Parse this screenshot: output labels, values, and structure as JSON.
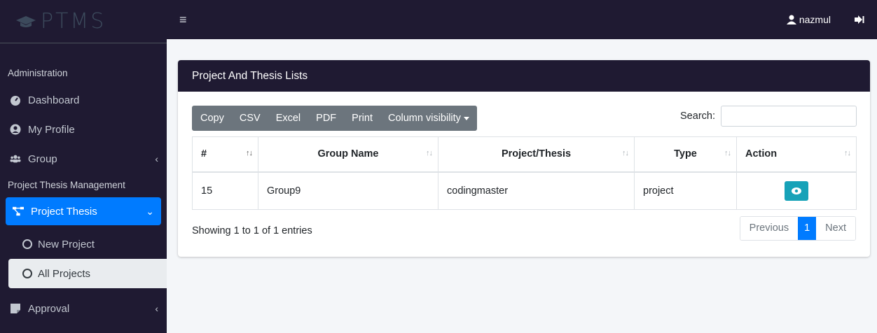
{
  "brand": {
    "text": "PTMS"
  },
  "sidebar": {
    "header_admin": "Administration",
    "dashboard": "Dashboard",
    "profile": "My Profile",
    "group": "Group",
    "header_pt": "Project Thesis Management",
    "project_thesis": "Project Thesis",
    "new_project": "New Project",
    "all_projects": "All Projects",
    "approval": "Approval"
  },
  "topbar": {
    "username": "nazmul"
  },
  "card": {
    "title": "Project And Thesis Lists",
    "buttons": [
      "Copy",
      "CSV",
      "Excel",
      "PDF",
      "Print",
      "Column visibility"
    ],
    "search_label": "Search:",
    "search_value": ""
  },
  "table": {
    "headers": [
      "#",
      "Group Name",
      "Project/Thesis",
      "Type",
      "Action"
    ],
    "rows": [
      {
        "id": "15",
        "group": "Group9",
        "project": "codingmaster",
        "type": "project"
      }
    ]
  },
  "footer": {
    "info": "Showing 1 to 1 of 1 entries",
    "previous": "Previous",
    "page": "1",
    "next": "Next"
  },
  "colors": {
    "dark": "#1f1a32",
    "primary": "#007bff",
    "info": "#17a2b8",
    "secondary": "#6c757d"
  }
}
